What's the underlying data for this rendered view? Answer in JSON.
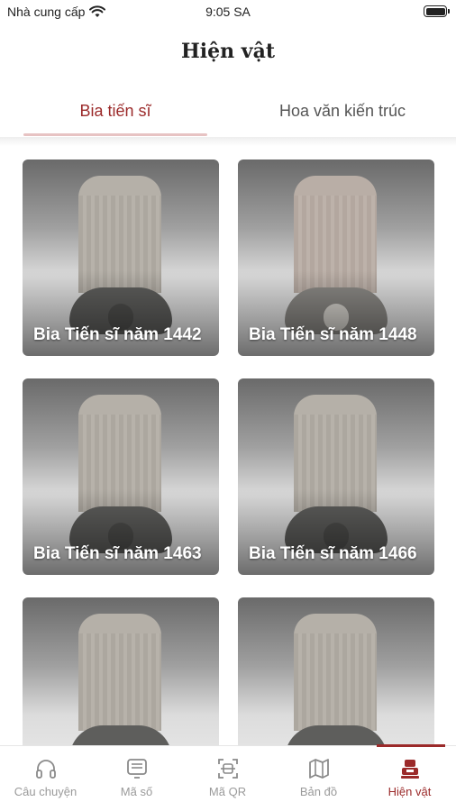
{
  "status_bar": {
    "carrier": "Nhà cung cấp",
    "time": "9:05 SA",
    "wifi_icon": "wifi-icon",
    "battery_icon": "battery-icon"
  },
  "header": {
    "title": "Hiện vật"
  },
  "tabs": [
    {
      "label": "Bia tiến sĩ",
      "active": true
    },
    {
      "label": "Hoa văn kiến trúc",
      "active": false
    }
  ],
  "cards": [
    {
      "label": "Bia Tiến sĩ năm 1442"
    },
    {
      "label": "Bia Tiến sĩ năm 1448"
    },
    {
      "label": "Bia Tiến sĩ năm 1463"
    },
    {
      "label": "Bia Tiến sĩ năm 1466"
    },
    {
      "label": ""
    },
    {
      "label": ""
    }
  ],
  "bottom_nav": [
    {
      "label": "Câu chuyện",
      "icon": "headphones-icon",
      "active": false
    },
    {
      "label": "Mã số",
      "icon": "keypad-icon",
      "active": false
    },
    {
      "label": "Mã QR",
      "icon": "qr-scan-icon",
      "active": false
    },
    {
      "label": "Bản đồ",
      "icon": "map-icon",
      "active": false
    },
    {
      "label": "Hiện vật",
      "icon": "artifact-icon",
      "active": true
    }
  ],
  "colors": {
    "accent": "#9b2a2a",
    "tab_underline": "#e7c3c3",
    "inactive_text": "#9a9a9a"
  }
}
